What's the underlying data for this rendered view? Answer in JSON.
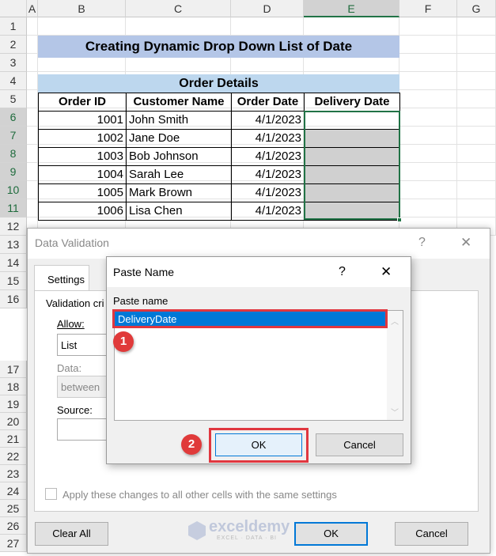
{
  "columns": [
    "A",
    "B",
    "C",
    "D",
    "E",
    "F",
    "G"
  ],
  "rows": [
    "1",
    "2",
    "3",
    "4",
    "5",
    "6",
    "7",
    "8",
    "9",
    "10",
    "11",
    "12",
    "13",
    "14",
    "15",
    "16",
    "17",
    "18",
    "19",
    "20",
    "21",
    "22",
    "23",
    "24",
    "25",
    "26",
    "27"
  ],
  "title": "Creating Dynamic Drop Down List of Date",
  "table": {
    "caption": "Order Details",
    "headers": [
      "Order ID",
      "Customer Name",
      "Order Date",
      "Delivery Date"
    ],
    "rows": [
      [
        "1001",
        "John Smith",
        "4/1/2023",
        ""
      ],
      [
        "1002",
        "Jane Doe",
        "4/1/2023",
        ""
      ],
      [
        "1003",
        "Bob Johnson",
        "4/1/2023",
        ""
      ],
      [
        "1004",
        "Sarah Lee",
        "4/1/2023",
        ""
      ],
      [
        "1005",
        "Mark Brown",
        "4/1/2023",
        ""
      ],
      [
        "1006",
        "Lisa Chen",
        "4/1/2023",
        ""
      ]
    ]
  },
  "data_validation": {
    "title": "Data Validation",
    "help": "?",
    "close": "✕",
    "tab": "Settings",
    "criteria": "Validation cri",
    "allow_label": "Allow:",
    "allow_value": "List",
    "data_label": "Data:",
    "data_value": "between",
    "source_label": "Source:",
    "apply_all": "Apply these changes to all other cells with the same settings",
    "clear_all": "Clear All",
    "ok": "OK",
    "cancel": "Cancel"
  },
  "paste_name": {
    "title": "Paste Name",
    "help": "?",
    "close": "✕",
    "label": "Paste name",
    "items": [
      "DeliveryDate"
    ],
    "ok": "OK",
    "cancel": "Cancel"
  },
  "badges": [
    "1",
    "2"
  ],
  "watermark": {
    "name": "exceldemy",
    "tag": "EXCEL · DATA · BI"
  },
  "colors": {
    "title_fill": "#b4c6e7",
    "caption_fill": "#bdd7ee",
    "accent": "#0078d7",
    "highlight": "#e03a3a"
  }
}
